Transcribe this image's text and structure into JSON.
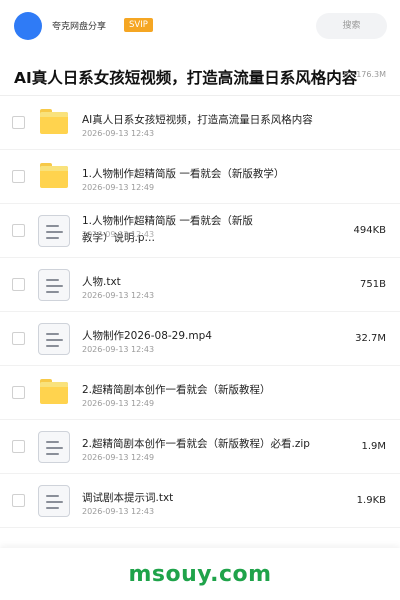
{
  "header": {
    "user_name": "夸克网盘分享",
    "badge": "SVIP",
    "search_placeholder": "搜索"
  },
  "share": {
    "title": "AI真人日系女孩短视频，打造高流量日系风格内容",
    "size_meta": "8 · 176.3M"
  },
  "files": [
    {
      "type": "folder",
      "name": "AI真人日系女孩短视频，打造高流量日系风格内容",
      "date": "2026-09-13 12:43",
      "size": ""
    },
    {
      "type": "folder",
      "name": "1.人物制作超精简版 一看就会（新版教学）",
      "date": "2026-09-13 12:49",
      "size": ""
    },
    {
      "type": "file",
      "name": "1.人物制作超精简版 一看就会（新版教学）说明.p…",
      "date": "2026-09-13 12:43",
      "size": "494KB"
    },
    {
      "type": "file",
      "name": "人物.txt",
      "date": "2026-09-13 12:43",
      "size": "751B"
    },
    {
      "type": "file",
      "name": "人物制作2026-08-29.mp4",
      "date": "2026-09-13 12:43",
      "size": "32.7M"
    },
    {
      "type": "folder",
      "name": "2.超精简剧本创作一看就会（新版教程）",
      "date": "2026-09-13 12:49",
      "size": ""
    },
    {
      "type": "file",
      "name": "2.超精简剧本创作一看就会（新版教程）必看.zip",
      "date": "2026-09-13 12:49",
      "size": "1.9M"
    },
    {
      "type": "file",
      "name": "调试剧本提示词.txt",
      "date": "2026-09-13 12:43",
      "size": "1.9KB"
    }
  ],
  "footer": {
    "watermark": "msouy.com"
  },
  "colors": {
    "avatar": "#2f7bf6",
    "badge": "#f5a623",
    "folder": "#ffd34e",
    "watermark": "#1fa34a"
  }
}
